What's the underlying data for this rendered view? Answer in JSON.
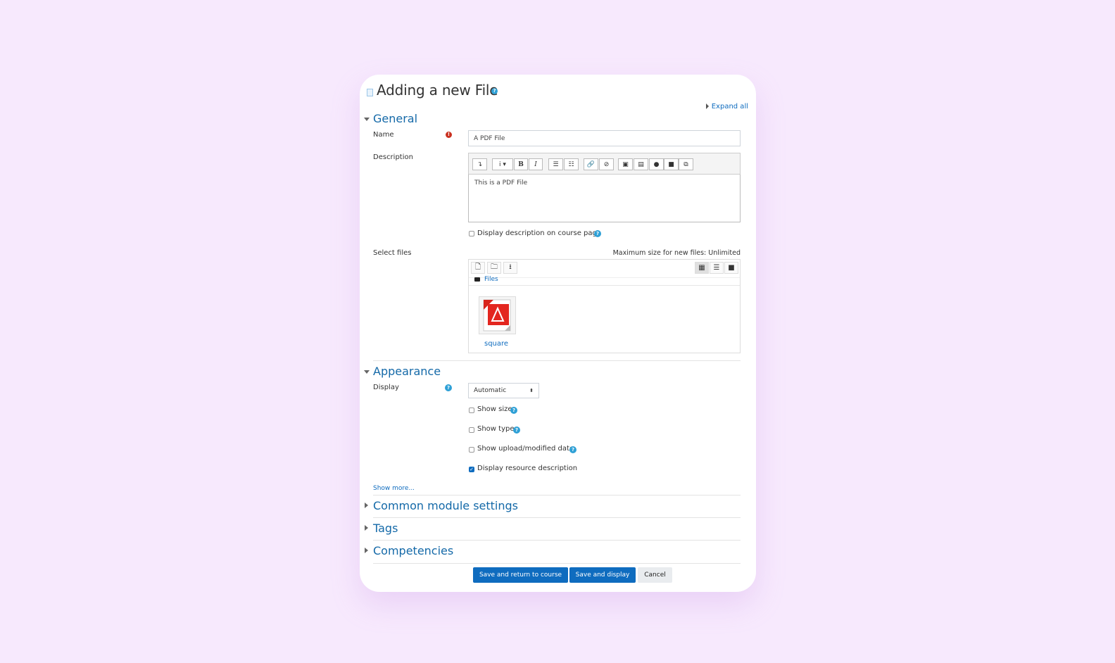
{
  "page": {
    "title": "Adding a new File",
    "expand_all": "Expand all"
  },
  "general": {
    "heading": "General",
    "name_label": "Name",
    "name_value": "A PDF File",
    "description_label": "Description",
    "description_text": "This is a PDF File",
    "display_desc_label": "Display description on course page",
    "select_files_label": "Select files",
    "max_size_text": "Maximum size for new files: Unlimited",
    "files_path": "Files",
    "file_name": "square"
  },
  "appearance": {
    "heading": "Appearance",
    "display_label": "Display",
    "display_value": "Automatic",
    "show_size": "Show size",
    "show_type": "Show type",
    "show_date": "Show upload/modified date",
    "display_resource_desc": "Display resource description",
    "display_resource_desc_checked": true,
    "show_more": "Show more..."
  },
  "sections": {
    "common": "Common module settings",
    "tags": "Tags",
    "competencies": "Competencies"
  },
  "buttons": {
    "save_return": "Save and return to course",
    "save_display": "Save and display",
    "cancel": "Cancel"
  },
  "colors": {
    "background": "#f7e9fd",
    "link": "#0f6cbf",
    "section": "#1469a8",
    "required": "#ca3120",
    "help": "#2ea0d6"
  }
}
